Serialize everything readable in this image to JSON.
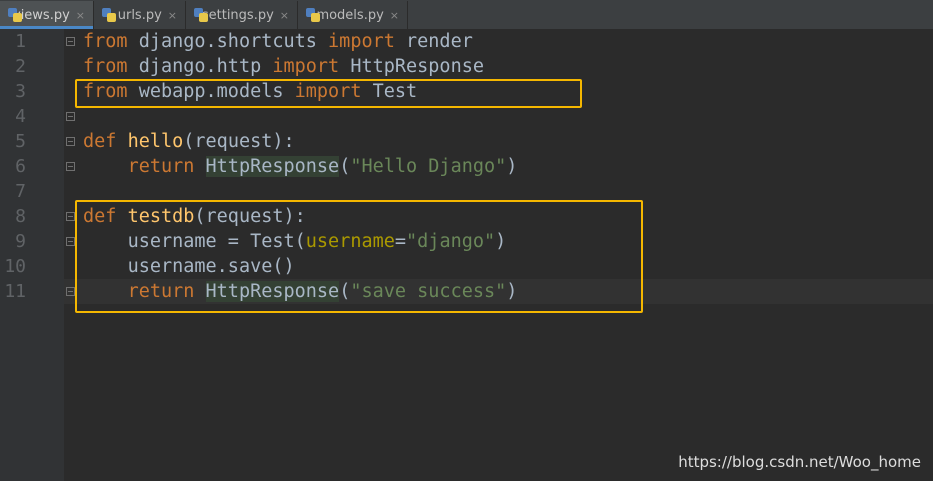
{
  "tabs": [
    {
      "label": "views.py",
      "active": true
    },
    {
      "label": "urls.py",
      "active": false
    },
    {
      "label": "settings.py",
      "active": false
    },
    {
      "label": "models.py",
      "active": false
    }
  ],
  "tab_close_glyph": "×",
  "line_numbers": [
    "1",
    "2",
    "3",
    "4",
    "5",
    "6",
    "7",
    "8",
    "9",
    "10",
    "11"
  ],
  "code": {
    "line1": {
      "kw1": "from",
      "mod": " django.shortcuts ",
      "kw2": "import",
      "name": " render"
    },
    "line2": {
      "kw1": "from",
      "mod": " django.http ",
      "kw2": "import",
      "name": " HttpResponse"
    },
    "line3": {
      "kw1": "from",
      "mod": " webapp.models ",
      "kw2": "import",
      "name": " Test"
    },
    "line5": {
      "kw": "def",
      "fn": "hello",
      "open": "(",
      "param": "request",
      "close": "):"
    },
    "line6": {
      "indent": "    ",
      "kw": "return",
      "cls": "HttpResponse",
      "open": "(",
      "str": "\"Hello Django\"",
      "close": ")"
    },
    "line8": {
      "kw": "def",
      "fn": "testdb",
      "open": "(",
      "param": "request",
      "close": "):"
    },
    "line9": {
      "indent": "    ",
      "pre": "username = Test(",
      "kwarg": "username",
      "eq": "=",
      "str": "\"django\"",
      "close": ")"
    },
    "line10": {
      "indent": "    ",
      "text": "username.save()"
    },
    "line11": {
      "indent": "    ",
      "kw": "return",
      "cls": "HttpResponse",
      "open": "(",
      "str": "\"save success\"",
      "close": ")"
    }
  },
  "watermark": "https://blog.csdn.net/Woo_home",
  "colors": {
    "background": "#2b2b2b",
    "keyword": "#cc7832",
    "function": "#ffc66d",
    "string": "#6a8759",
    "kwarg": "#aa9900",
    "highlight_box": "#f5b700"
  }
}
